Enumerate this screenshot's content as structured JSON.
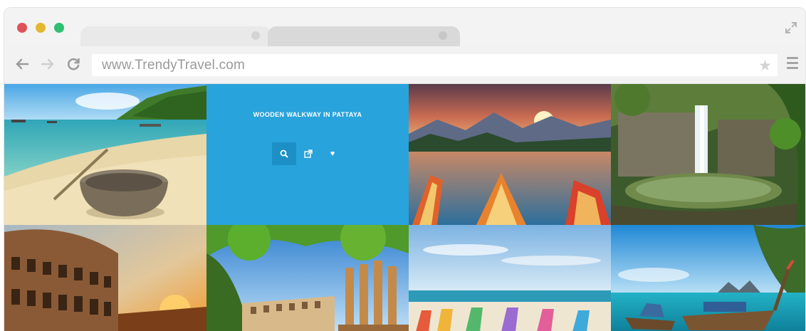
{
  "browser": {
    "url": "www.TrendyTravel.com",
    "icons": {
      "back": "back-arrow-icon",
      "forward": "forward-arrow-icon",
      "reload": "reload-icon",
      "bookmark": "star-icon",
      "menu": "hamburger-menu-icon",
      "fullscreen": "expand-icon"
    }
  },
  "gallery": {
    "hover_title": "WOODEN WALKWAY IN PATTAYA",
    "hover_actions": [
      "zoom-icon",
      "external-link-icon",
      "heart-icon"
    ],
    "accent_color": "#29a3db"
  }
}
